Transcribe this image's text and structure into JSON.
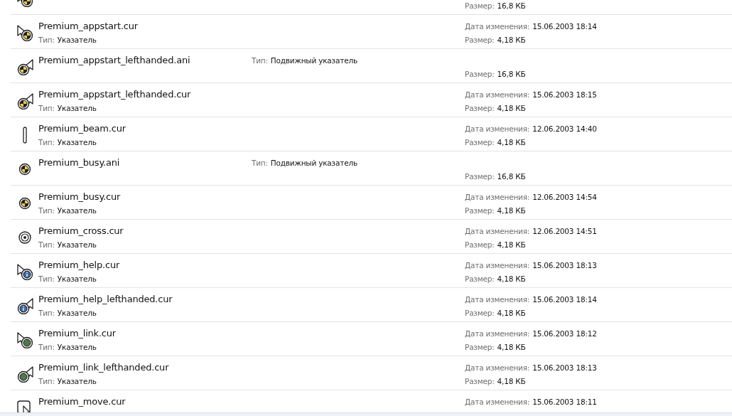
{
  "files": [
    {
      "kind": "animated",
      "size": {
        "label": "Размер:",
        "value": "16,8 КБ"
      }
    },
    {
      "kind": "static",
      "name": "Premium_appstart.cur",
      "type": {
        "label": "Тип:",
        "value": "Указатель"
      },
      "date": {
        "label": "Дата изменения:",
        "value": "15.06.2003 18:14"
      },
      "size": {
        "label": "Размер:",
        "value": "4,18 КБ"
      }
    },
    {
      "kind": "animated",
      "name": "Premium_appstart_lefthanded.ani",
      "type": {
        "label": "Тип:",
        "value": "Подвижный указатель"
      },
      "size": {
        "label": "Размер:",
        "value": "16,8 КБ"
      }
    },
    {
      "kind": "static",
      "name": "Premium_appstart_lefthanded.cur",
      "type": {
        "label": "Тип:",
        "value": "Указатель"
      },
      "date": {
        "label": "Дата изменения:",
        "value": "15.06.2003 18:15"
      },
      "size": {
        "label": "Размер:",
        "value": "4,18 КБ"
      }
    },
    {
      "kind": "static",
      "name": "Premium_beam.cur",
      "type": {
        "label": "Тип:",
        "value": "Указатель"
      },
      "date": {
        "label": "Дата изменения:",
        "value": "12.06.2003 14:40"
      },
      "size": {
        "label": "Размер:",
        "value": "4,18 КБ"
      }
    },
    {
      "kind": "animated",
      "name": "Premium_busy.ani",
      "type": {
        "label": "Тип:",
        "value": "Подвижный указатель"
      },
      "size": {
        "label": "Размер:",
        "value": "16,8 КБ"
      }
    },
    {
      "kind": "static",
      "name": "Premium_busy.cur",
      "type": {
        "label": "Тип:",
        "value": "Указатель"
      },
      "date": {
        "label": "Дата изменения:",
        "value": "12.06.2003 14:54"
      },
      "size": {
        "label": "Размер:",
        "value": "4,18 КБ"
      }
    },
    {
      "kind": "static",
      "name": "Premium_cross.cur",
      "type": {
        "label": "Тип:",
        "value": "Указатель"
      },
      "date": {
        "label": "Дата изменения:",
        "value": "12.06.2003 14:51"
      },
      "size": {
        "label": "Размер:",
        "value": "4,18 КБ"
      }
    },
    {
      "kind": "static",
      "name": "Premium_help.cur",
      "type": {
        "label": "Тип:",
        "value": "Указатель"
      },
      "date": {
        "label": "Дата изменения:",
        "value": "15.06.2003 18:13"
      },
      "size": {
        "label": "Размер:",
        "value": "4,18 КБ"
      }
    },
    {
      "kind": "static",
      "name": "Premium_help_lefthanded.cur",
      "type": {
        "label": "Тип:",
        "value": "Указатель"
      },
      "date": {
        "label": "Дата изменения:",
        "value": "15.06.2003 18:14"
      },
      "size": {
        "label": "Размер:",
        "value": "4,18 КБ"
      }
    },
    {
      "kind": "static",
      "name": "Premium_link.cur",
      "type": {
        "label": "Тип:",
        "value": "Указатель"
      },
      "date": {
        "label": "Дата изменения:",
        "value": "15.06.2003 18:12"
      },
      "size": {
        "label": "Размер:",
        "value": "4,18 КБ"
      }
    },
    {
      "kind": "static",
      "name": "Premium_link_lefthanded.cur",
      "type": {
        "label": "Тип:",
        "value": "Указатель"
      },
      "date": {
        "label": "Дата изменения:",
        "value": "15.06.2003 18:13"
      },
      "size": {
        "label": "Размер:",
        "value": "4,18 КБ"
      }
    },
    {
      "kind": "static",
      "name": "Premium_move.cur",
      "date": {
        "label": "Дата изменения:",
        "value": "15.06.2003 18:11"
      }
    }
  ]
}
